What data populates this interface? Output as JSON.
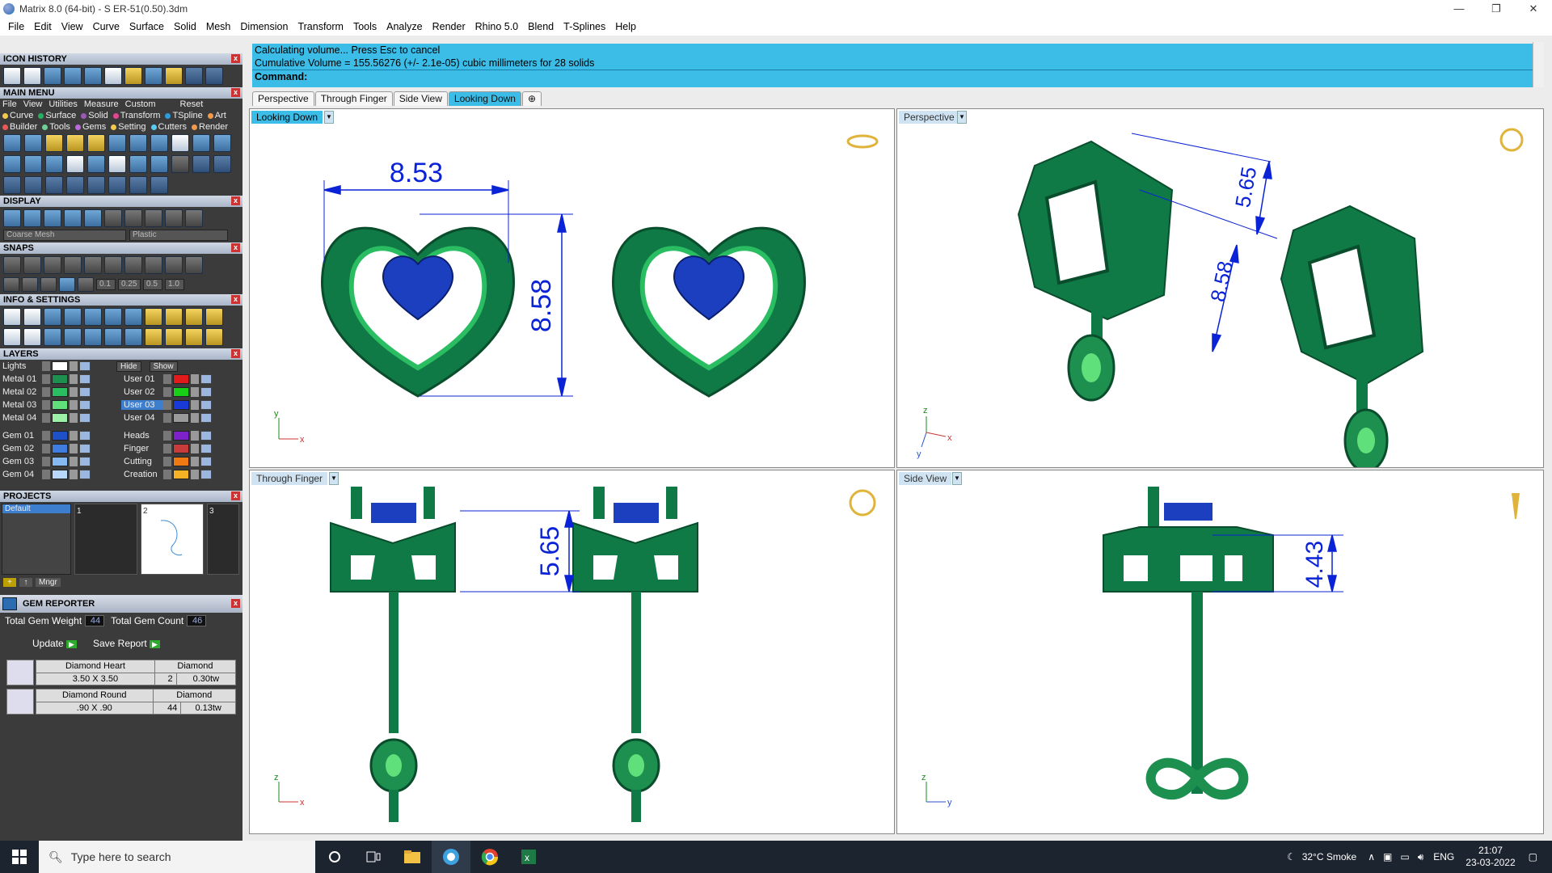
{
  "window": {
    "title": "Matrix 8.0 (64-bit) - S ER-51(0.50).3dm"
  },
  "menu": [
    "File",
    "Edit",
    "View",
    "Curve",
    "Surface",
    "Solid",
    "Mesh",
    "Dimension",
    "Transform",
    "Tools",
    "Analyze",
    "Render",
    "Rhino 5.0",
    "Blend",
    "T-Splines",
    "Help"
  ],
  "command": {
    "line1": "Calculating volume... Press Esc to cancel",
    "line2": "Cumulative Volume = 155.56276 (+/- 2.1e-05) cubic millimeters for 28 solids",
    "prompt": "Command:"
  },
  "tabs": [
    "Perspective",
    "Through Finger",
    "Side View",
    "Looking Down",
    "⊕"
  ],
  "panels": {
    "icon_history": "ICON HISTORY",
    "main_menu": "MAIN MENU",
    "main_menu_items": [
      "File",
      "View",
      "Utilities",
      "Measure",
      "Custom",
      "Reset"
    ],
    "categories_row1": [
      "Curve",
      "Surface",
      "Solid",
      "Transform",
      "TSpline",
      "Art"
    ],
    "categories_row2": [
      "Builder",
      "Tools",
      "Gems",
      "Setting",
      "Cutters",
      "Render"
    ],
    "display": "DISPLAY",
    "display_mesh": "Coarse Mesh",
    "display_material": "Plastic",
    "snaps": "SNAPS",
    "snap_values": [
      "0.1",
      "0.25",
      "0.5",
      "1.0"
    ],
    "info": "INFO & SETTINGS",
    "layers": "LAYERS",
    "projects": "PROJECTS",
    "gem_reporter": "GEM REPORTER"
  },
  "layers": {
    "lights": "Lights",
    "hide": "Hide",
    "show": "Show",
    "left": [
      {
        "name": "Metal 01",
        "color": "#1d8f4f"
      },
      {
        "name": "Metal 02",
        "color": "#2bbd62"
      },
      {
        "name": "Metal 03",
        "color": "#5fe07a"
      },
      {
        "name": "Metal 04",
        "color": "#9cf0a8"
      },
      {
        "name": "Gem 01",
        "color": "#1e50c8"
      },
      {
        "name": "Gem 02",
        "color": "#3f7de0"
      },
      {
        "name": "Gem 03",
        "color": "#86b8f2"
      },
      {
        "name": "Gem 04",
        "color": "#b8d7fa"
      }
    ],
    "right": [
      {
        "name": "User 01",
        "color": "#e11b1b"
      },
      {
        "name": "User 02",
        "color": "#19d019"
      },
      {
        "name": "User 03",
        "color": "#1a3ad8"
      },
      {
        "name": "User 04",
        "color": "#9a9a9a"
      },
      {
        "name": "Heads",
        "color": "#7d22c8"
      },
      {
        "name": "Finger",
        "color": "#c83b3b"
      },
      {
        "name": "Cutting",
        "color": "#f07a12"
      },
      {
        "name": "Creation",
        "color": "#f4b224"
      }
    ]
  },
  "projects": {
    "default": "Default",
    "slots": [
      "1",
      "2",
      "3"
    ],
    "mngr": "Mngr"
  },
  "gem_report": {
    "total_weight_label": "Total Gem Weight",
    "total_weight": "44",
    "total_count_label": "Total Gem Count",
    "total_count": "46",
    "update": "Update",
    "save": "Save Report",
    "rows": [
      {
        "cut": "Diamond Heart",
        "type": "Diamond",
        "size": "3.50 X 3.50",
        "count": "2",
        "weight": "0.30tw"
      },
      {
        "cut": "Diamond Round",
        "type": "Diamond",
        "size": ".90 X .90",
        "count": "44",
        "weight": "0.13tw"
      }
    ]
  },
  "viewports": {
    "top_left": {
      "label": "Looking Down",
      "dim_w": "8.53",
      "dim_h": "8.58",
      "ax1": "y",
      "ax2": "x"
    },
    "top_right": {
      "label": "Perspective",
      "dim1": "5.65",
      "dim2": "8.58",
      "ax1": "z",
      "ax2": "x",
      "ax3": "y"
    },
    "bottom_left": {
      "label": "Through Finger",
      "dim": "5.65",
      "ax1": "z",
      "ax2": "x"
    },
    "bottom_right": {
      "label": "Side View",
      "dim": "4.43",
      "ax1": "z",
      "ax2": "y"
    }
  },
  "taskbar": {
    "search": "Type here to search",
    "weather": "32°C  Smoke",
    "lang": "ENG",
    "time": "21:07",
    "date": "23-03-2022"
  },
  "colors": {
    "accent": "#3bbde8",
    "metal": "#0f7a45",
    "gem": "#1c3fbf",
    "dim": "#0b23d6"
  }
}
